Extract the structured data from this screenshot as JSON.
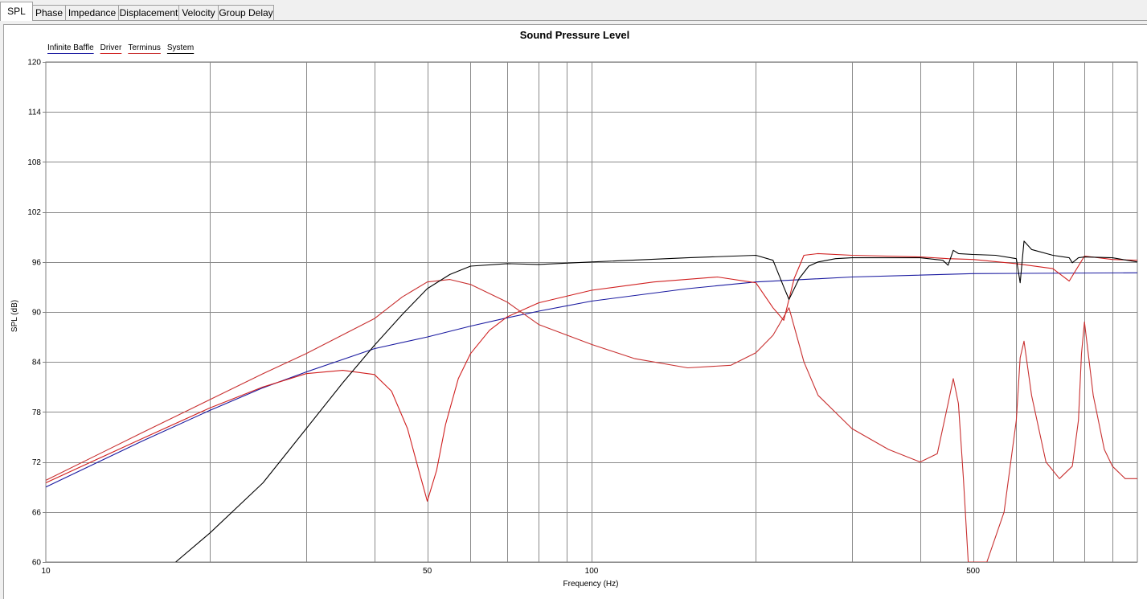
{
  "tabs": [
    {
      "label": "SPL",
      "active": true
    },
    {
      "label": "Phase",
      "active": false
    },
    {
      "label": "Impedance",
      "active": false
    },
    {
      "label": "Displacement",
      "active": false
    },
    {
      "label": "Velocity",
      "active": false
    },
    {
      "label": "Group Delay",
      "active": false
    }
  ],
  "chart_data": {
    "type": "line",
    "title": "Sound Pressure Level",
    "xlabel": "Frequency (Hz)",
    "ylabel": "SPL (dB)",
    "x_scale": "log",
    "xlim": [
      10,
      1000
    ],
    "ylim": [
      60,
      120
    ],
    "grid": true,
    "legend_position": "top-left",
    "x_tick_labels": [
      {
        "value": 10,
        "label": "10"
      },
      {
        "value": 50,
        "label": "50"
      },
      {
        "value": 100,
        "label": "100"
      },
      {
        "value": 500,
        "label": "500"
      }
    ],
    "y_ticks": [
      60,
      66,
      72,
      78,
      84,
      90,
      96,
      102,
      108,
      114,
      120
    ],
    "legend": [
      {
        "name": "Infinite Baffle",
        "color": "#1a1aa0"
      },
      {
        "name": "Driver",
        "color": "#d02020"
      },
      {
        "name": "Terminus",
        "color": "#c83030"
      },
      {
        "name": "System",
        "color": "#000000"
      }
    ],
    "series": [
      {
        "name": "Infinite Baffle",
        "color": "#1a1aa0",
        "x": [
          10,
          15,
          20,
          25,
          30,
          40,
          50,
          60,
          70,
          80,
          100,
          150,
          200,
          300,
          500,
          1000
        ],
        "y": [
          69.0,
          74.5,
          78.2,
          80.9,
          82.8,
          85.6,
          87.0,
          88.3,
          89.3,
          90.1,
          91.3,
          92.8,
          93.6,
          94.2,
          94.6,
          94.7
        ]
      },
      {
        "name": "Driver",
        "color": "#d02020",
        "x": [
          10,
          15,
          20,
          25,
          30,
          35,
          40,
          43,
          46,
          48,
          50,
          52,
          54,
          57,
          60,
          65,
          70,
          80,
          100,
          130,
          170,
          200,
          215,
          225,
          235,
          245,
          260,
          300,
          400,
          450,
          500,
          600,
          700,
          750,
          800,
          900,
          1000
        ],
        "y": [
          69.5,
          74.8,
          78.5,
          81.0,
          82.6,
          83.0,
          82.5,
          80.5,
          76.0,
          71.5,
          67.3,
          71.0,
          76.5,
          82.0,
          85.0,
          87.8,
          89.4,
          91.1,
          92.6,
          93.6,
          94.2,
          93.5,
          90.5,
          89.0,
          94.0,
          96.8,
          97.0,
          96.8,
          96.6,
          96.4,
          96.3,
          95.8,
          95.2,
          93.7,
          96.7,
          96.3,
          96.2
        ]
      },
      {
        "name": "Terminus",
        "color": "#c83030",
        "x": [
          10,
          15,
          20,
          25,
          30,
          40,
          45,
          50,
          55,
          60,
          70,
          80,
          100,
          120,
          150,
          180,
          200,
          215,
          230,
          245,
          260,
          300,
          350,
          400,
          430,
          450,
          460,
          470,
          480,
          490,
          530,
          570,
          600,
          610,
          620,
          640,
          680,
          720,
          760,
          780,
          790,
          800,
          830,
          870,
          900,
          950,
          1000
        ],
        "y": [
          69.8,
          75.5,
          79.5,
          82.6,
          85.0,
          89.2,
          91.8,
          93.6,
          93.9,
          93.3,
          91.2,
          88.5,
          86.1,
          84.4,
          83.3,
          83.6,
          85.1,
          87.2,
          90.5,
          84.0,
          80.0,
          76.0,
          73.5,
          72.0,
          73.0,
          79.0,
          82.0,
          79.0,
          70.0,
          60.0,
          60.0,
          66.0,
          77.0,
          84.5,
          86.5,
          80.0,
          72.0,
          70.0,
          71.5,
          77.0,
          85.0,
          88.8,
          80.0,
          73.5,
          71.5,
          70.0,
          70.0
        ]
      },
      {
        "name": "System",
        "color": "#000000",
        "x": [
          17.3,
          20,
          25,
          30,
          35,
          40,
          45,
          50,
          55,
          60,
          70,
          80,
          100,
          150,
          200,
          215,
          225,
          230,
          240,
          250,
          260,
          280,
          300,
          400,
          440,
          450,
          460,
          470,
          500,
          550,
          600,
          610,
          620,
          640,
          700,
          750,
          760,
          780,
          800,
          900,
          1000
        ],
        "y": [
          60,
          63.5,
          69.5,
          76.0,
          81.5,
          86.0,
          89.7,
          92.8,
          94.5,
          95.5,
          95.8,
          95.7,
          96.0,
          96.5,
          96.8,
          96.2,
          93.0,
          91.5,
          94.0,
          95.5,
          96.0,
          96.4,
          96.5,
          96.5,
          96.2,
          95.6,
          97.4,
          97.0,
          96.9,
          96.8,
          96.4,
          93.5,
          98.5,
          97.5,
          96.8,
          96.5,
          95.9,
          96.5,
          96.6,
          96.5,
          96.0
        ]
      }
    ]
  }
}
